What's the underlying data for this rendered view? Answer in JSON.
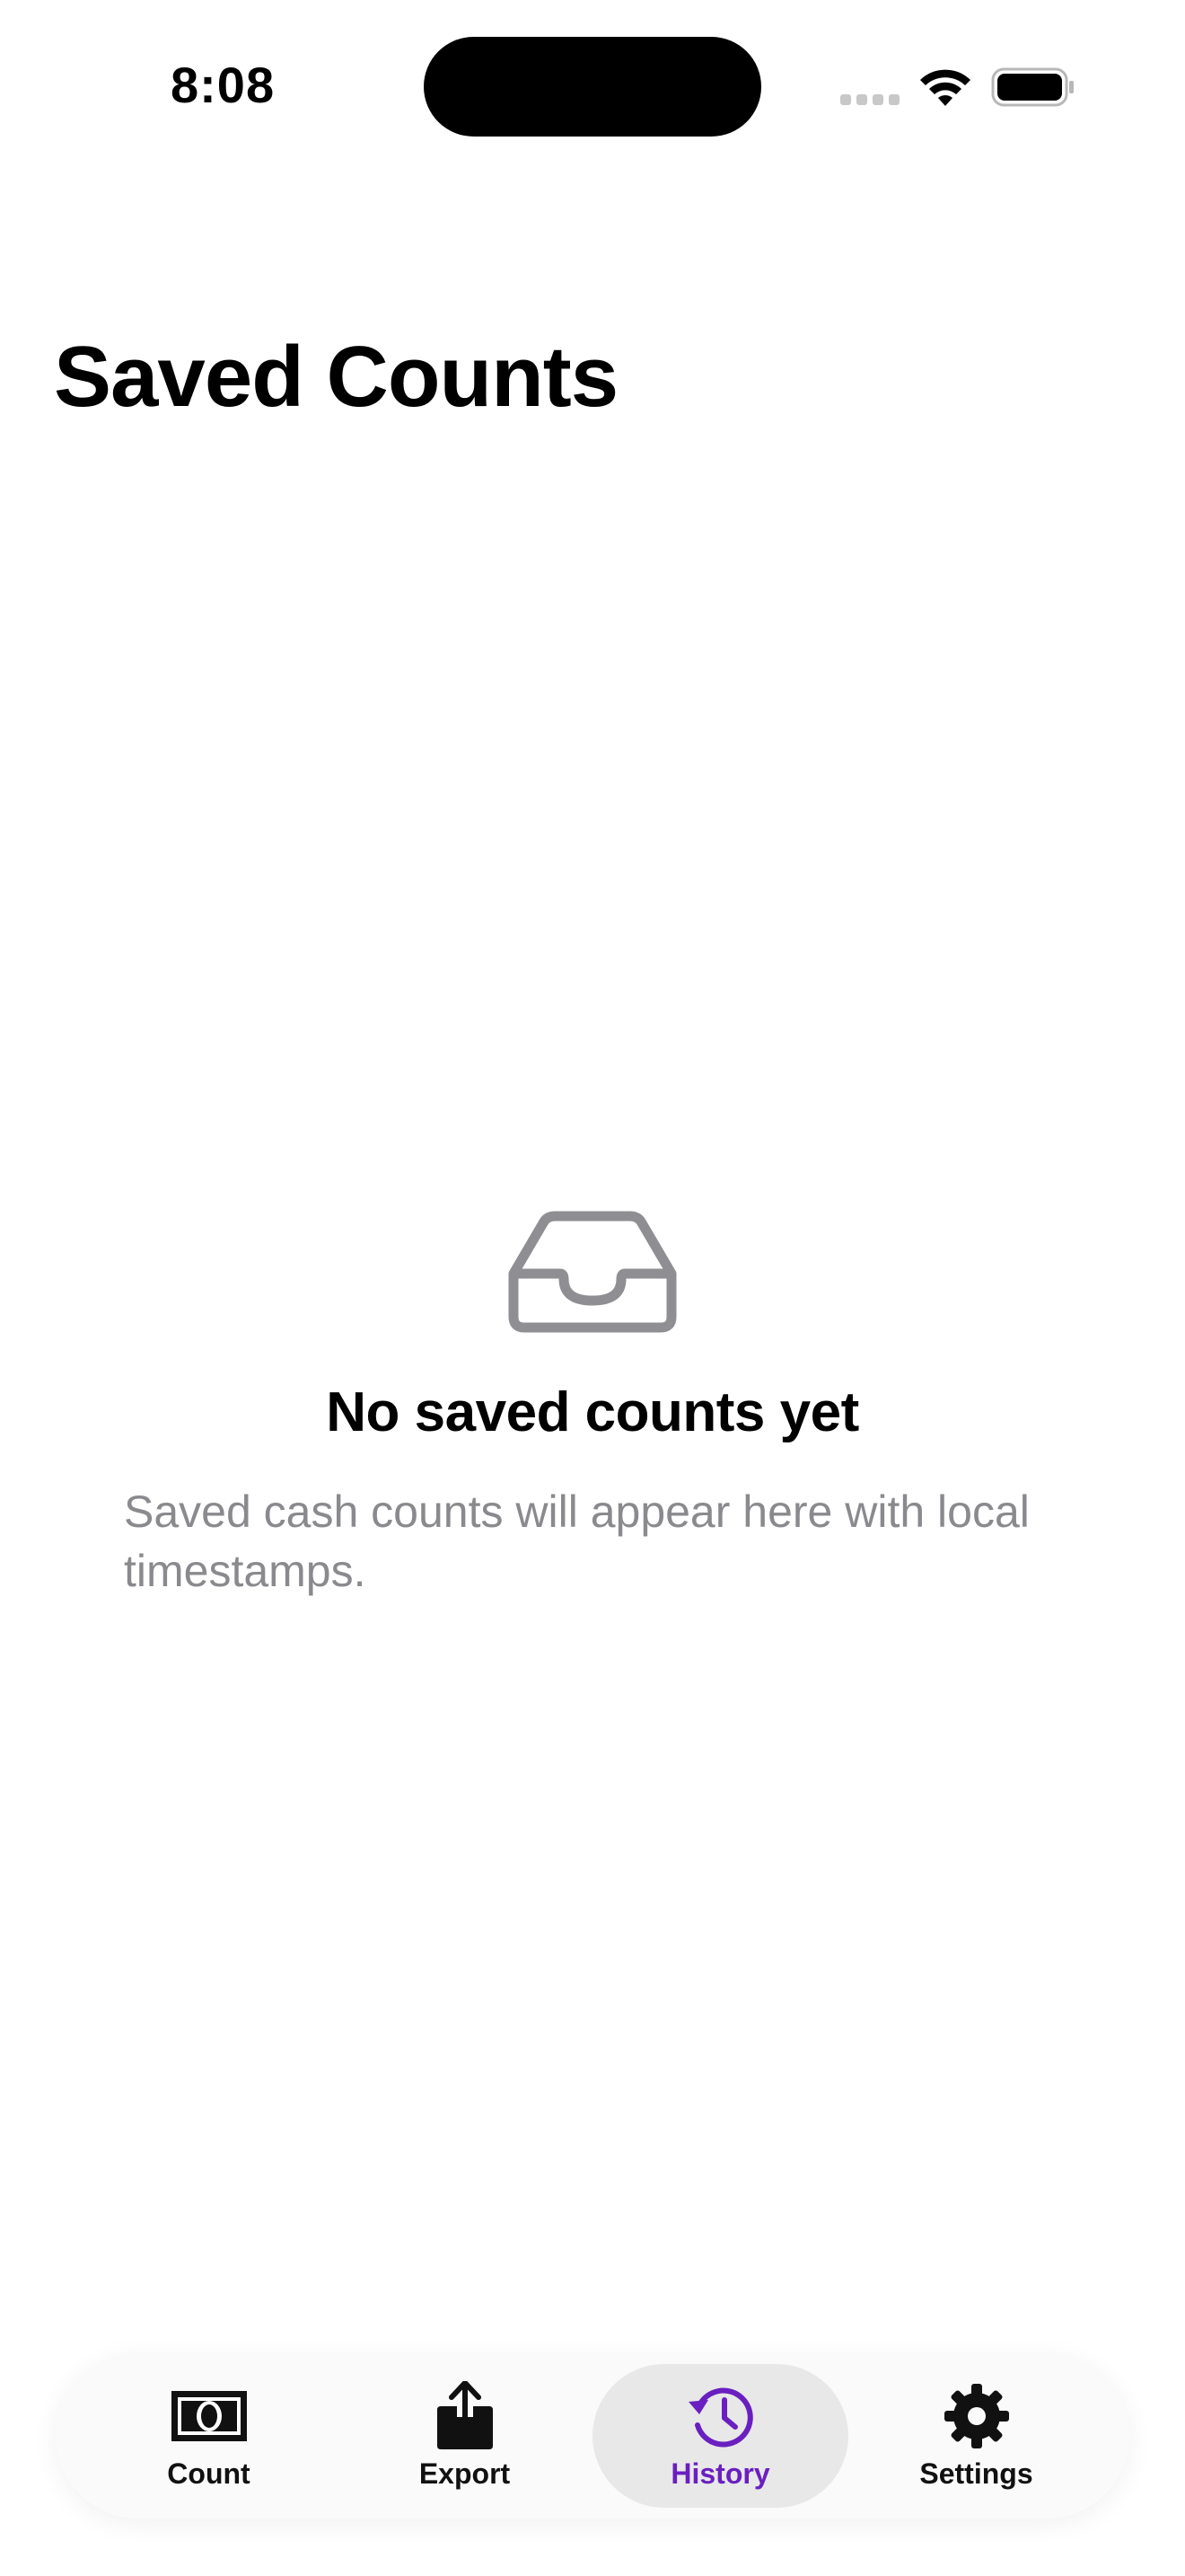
{
  "status_bar": {
    "time": "8:08",
    "icons": [
      "cellular-icon",
      "wifi-icon",
      "battery-icon"
    ]
  },
  "page": {
    "title": "Saved Counts"
  },
  "empty_state": {
    "icon": "inbox-tray-icon",
    "title": "No saved counts yet",
    "description": "Saved cash counts will appear here with local timestamps."
  },
  "tab_bar": {
    "active_color": "#6a1fc0",
    "tabs": [
      {
        "label": "Count",
        "icon": "banknote-icon",
        "active": false
      },
      {
        "label": "Export",
        "icon": "share-icon",
        "active": false
      },
      {
        "label": "History",
        "icon": "history-clock-icon",
        "active": true
      },
      {
        "label": "Settings",
        "icon": "gear-icon",
        "active": false
      }
    ]
  }
}
